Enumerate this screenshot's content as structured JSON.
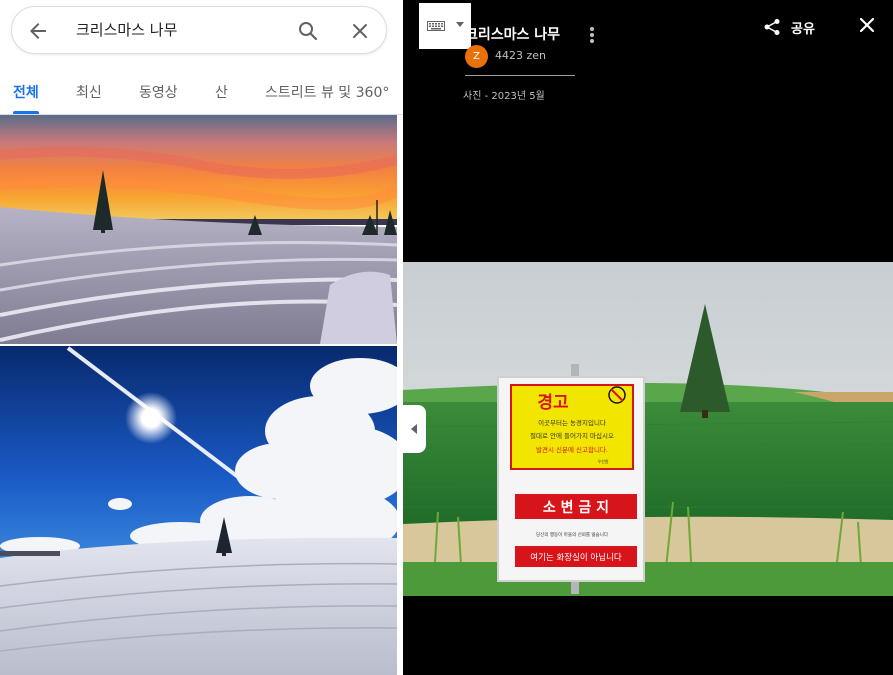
{
  "search": {
    "query": "크리스마스 나무",
    "back_icon": "arrow-back-icon",
    "search_icon": "search-icon",
    "clear_icon": "close-icon"
  },
  "tabs": [
    {
      "label": "전체",
      "active": true
    },
    {
      "label": "최신",
      "active": false
    },
    {
      "label": "동영상",
      "active": false
    },
    {
      "label": "산",
      "active": false
    },
    {
      "label": "스트리트 뷰 및 360°",
      "active": false
    }
  ],
  "results": [
    {
      "scene": "snowy field with lone tree at orange sunset"
    },
    {
      "scene": "snowy field with lone tree under blue sky with sun and clouds"
    }
  ],
  "viewer": {
    "place_title": "크리스마스 나무",
    "author_initial": "Z",
    "author_name": "4423 zen",
    "photo_meta": "사진 - 2023년 5월",
    "share_label": "공유",
    "photo": {
      "sign_warning_title": "경고",
      "sign_line_1": "이곳부터는 농경지입니다",
      "sign_line_2": "절대로 안에 들어가지 마십시오",
      "sign_line_3": "발견시 신분에 신고합니다.",
      "sign_small_footer": "우선원",
      "sign_banner_1": "소 변 금 지",
      "sign_small_middle": "당신의 행동이 마을의 신뢰를 잃습니다",
      "sign_banner_2": "여기는 화장실이 아닙니다"
    }
  },
  "colors": {
    "accent": "#1a73e8",
    "avatar": "#e8710a",
    "sign_yellow": "#f2e600",
    "sign_red": "#d8141b"
  }
}
